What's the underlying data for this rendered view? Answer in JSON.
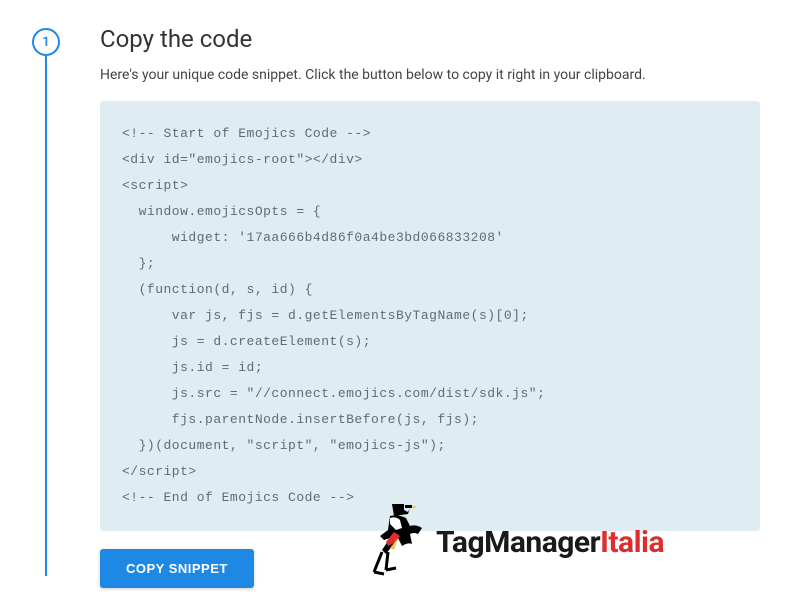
{
  "step": {
    "number": "1",
    "title": "Copy the code",
    "description": "Here's your unique code snippet. Click the button below to copy it right in your clipboard."
  },
  "code_snippet": "<!-- Start of Emojics Code -->\n<div id=\"emojics-root\"></div>\n<script>\n  window.emojicsOpts = {\n      widget: '17aa666b4d86f0a4be3bd066833208'\n  };\n  (function(d, s, id) {\n      var js, fjs = d.getElementsByTagName(s)[0];\n      js = d.createElement(s);\n      js.id = id;\n      js.src = \"//connect.emojics.com/dist/sdk.js\";\n      fjs.parentNode.insertBefore(js, fjs);\n  })(document, \"script\", \"emojics-js\");\n</script>\n<!-- End of Emojics Code -->",
  "button": {
    "copy_label": "COPY SNIPPET"
  },
  "logo": {
    "part1": "TagManager",
    "part2": "Italia"
  }
}
